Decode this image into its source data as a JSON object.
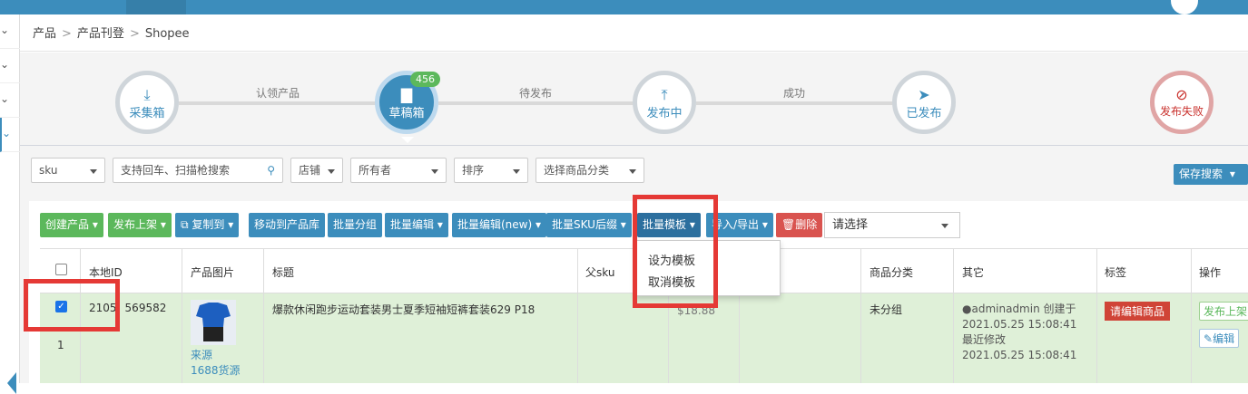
{
  "breadcrumb": {
    "items": [
      "产品",
      "产品刊登",
      "Shopee"
    ],
    "sep": ">"
  },
  "workflow": {
    "steps": [
      {
        "label": "采集箱",
        "icon": "download-icon",
        "state": "normal"
      },
      {
        "label": "草稿箱",
        "icon": "folder-icon",
        "state": "active",
        "badge": "456"
      },
      {
        "label": "发布中",
        "icon": "upload-icon",
        "state": "normal"
      },
      {
        "label": "已发布",
        "icon": "send-icon",
        "state": "normal"
      },
      {
        "label": "发布失败",
        "icon": "eye-slash-icon",
        "state": "fail"
      }
    ],
    "connectors": [
      "认领产品",
      "待发布",
      "成功"
    ]
  },
  "filters": {
    "sku": "sku",
    "search_placeholder": "支持回车、扫描枪搜索",
    "shop": "店铺",
    "owner": "所有者",
    "sort": "排序",
    "category": "选择商品分类",
    "save_search": "保存搜索"
  },
  "toolbar": {
    "create": "创建产品",
    "publish": "发布上架",
    "copy": "复制到",
    "move": "移动到产品库",
    "batch_group": "批量分组",
    "batch_edit": "批量编辑",
    "batch_edit_new": "批量编辑(new)",
    "batch_sku_suffix": "批量SKU后缀",
    "batch_template": "批量模板",
    "import_export": "导入/导出",
    "delete": "删除",
    "select_placeholder": "请选择"
  },
  "dropdown": {
    "items": [
      "设为模板",
      "取消模板"
    ]
  },
  "table": {
    "headers": [
      "本地ID",
      "产品图片",
      "标题",
      "父sku",
      "商品分类",
      "其它",
      "标签",
      "操作"
    ],
    "rows": [
      {
        "index": "1",
        "checked": true,
        "id": "2105",
        "id_tail": "569582",
        "image_source_label": "来源",
        "image_source": "1688货源",
        "title": "爆款休闲跑步运动套装男士夏季短袖短裤套装629 P18",
        "price": "$18.88",
        "category": "未分组",
        "creator": "adminadmin 创建于",
        "created_at": "2021.05.25 15:08:41",
        "modified_label": "最近修改",
        "modified_at": "2021.05.25 15:08:41",
        "tag": "请编辑商品",
        "op_publish": "发布上架",
        "op_edit": "编辑"
      }
    ]
  },
  "colors": {
    "primary": "#3c8dbc",
    "success": "#5cb85c",
    "danger": "#d9534f",
    "highlight": "#e53935"
  }
}
